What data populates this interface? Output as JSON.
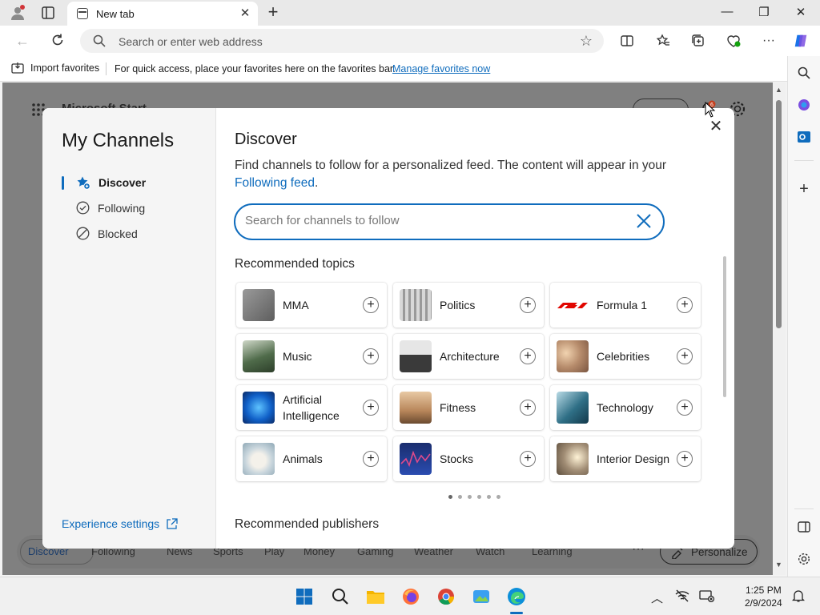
{
  "browser": {
    "tab_title": "New tab",
    "address_placeholder": "Search or enter web address"
  },
  "favorites_bar": {
    "import_label": "Import favorites",
    "message": "For quick access, place your favorites here on the favorites bar.",
    "manage_link": "Manage favorites now"
  },
  "background_page": {
    "brand": "Microsoft Start",
    "bottom_nav": [
      {
        "label": "Discover",
        "active": true
      },
      {
        "label": "Following"
      },
      {
        "label": "News"
      },
      {
        "label": "Sports"
      },
      {
        "label": "Play"
      },
      {
        "label": "Money"
      },
      {
        "label": "Gaming"
      },
      {
        "label": "Weather"
      },
      {
        "label": "Watch"
      },
      {
        "label": "Learning"
      }
    ],
    "more_label": "···",
    "personalize_label": "Personalize",
    "notification_count": "6"
  },
  "modal": {
    "title": "My Channels",
    "nav": [
      {
        "label": "Discover",
        "icon": "star-plus-icon",
        "active": true
      },
      {
        "label": "Following",
        "icon": "check-circle-icon"
      },
      {
        "label": "Blocked",
        "icon": "blocked-icon"
      }
    ],
    "experience_settings": "Experience settings",
    "discover": {
      "title": "Discover",
      "description_prefix": "Find channels to follow for a personalized feed. The content will appear in your ",
      "description_link": "Following feed",
      "description_suffix": ".",
      "search_placeholder": "Search for channels to follow",
      "recommended_topics_title": "Recommended topics",
      "topics": [
        {
          "label": "MMA",
          "color": "#7d7d7d"
        },
        {
          "label": "Politics",
          "color": "#bdbdbd"
        },
        {
          "label": "Formula 1",
          "color": "#e10600"
        },
        {
          "label": "Music",
          "color": "#4f6b4a"
        },
        {
          "label": "Architecture",
          "color": "#3a3a3a"
        },
        {
          "label": "Celebrities",
          "color": "#b58a6a"
        },
        {
          "label": "Artificial Intelligence",
          "color": "#1060c8"
        },
        {
          "label": "Fitness",
          "color": "#b8865a"
        },
        {
          "label": "Technology",
          "color": "#2f6f86"
        },
        {
          "label": "Animals",
          "color": "#c9d6dd"
        },
        {
          "label": "Stocks",
          "color": "#1a2d6e"
        },
        {
          "label": "Interior Design",
          "color": "#a08c74"
        }
      ],
      "carousel_pages": 6,
      "carousel_active": 1,
      "recommended_publishers_title": "Recommended publishers"
    }
  },
  "taskbar": {
    "time": "1:25 PM",
    "date": "2/9/2024"
  },
  "colors": {
    "accent": "#0f6cbd",
    "dim_overlay": "#808080"
  }
}
